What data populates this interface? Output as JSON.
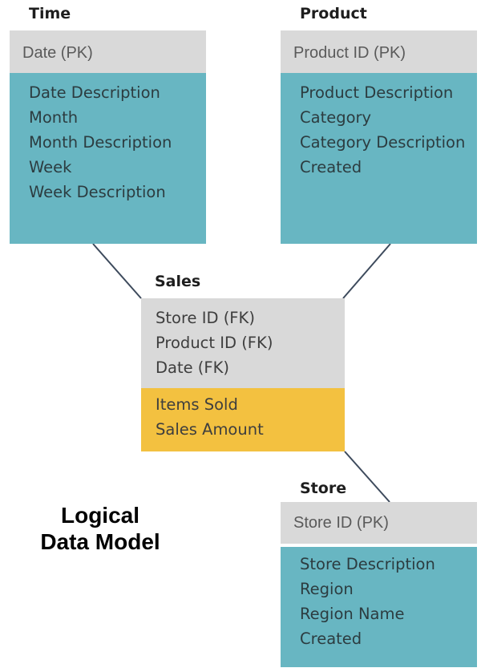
{
  "diagram": {
    "caption_lines": [
      "Logical",
      "Data Model"
    ],
    "colors": {
      "header": "#d9d9d9",
      "dimension_body": "#68b6c2",
      "measures": "#f3c140",
      "connector": "#3d4a5c"
    },
    "entities": {
      "time": {
        "title": "Time",
        "key": "Date (PK)",
        "attributes": [
          "Date Description",
          "Month",
          "Month Description",
          "Week",
          "Week Description"
        ]
      },
      "product": {
        "title": "Product",
        "key": "Product ID (PK)",
        "attributes": [
          "Product Description",
          "Category",
          "Category Description",
          "Created"
        ]
      },
      "sales": {
        "title": "Sales",
        "keys": [
          "Store ID (FK)",
          "Product ID (FK)",
          "Date (FK)"
        ],
        "measures": [
          "Items Sold",
          "Sales Amount"
        ]
      },
      "store": {
        "title": "Store",
        "key": "Store ID (PK)",
        "attributes": [
          "Store Description",
          "Region",
          "Region Name",
          "Created"
        ]
      }
    },
    "relationships": [
      {
        "from": "time",
        "to": "sales"
      },
      {
        "from": "product",
        "to": "sales"
      },
      {
        "from": "sales",
        "to": "store"
      }
    ]
  }
}
